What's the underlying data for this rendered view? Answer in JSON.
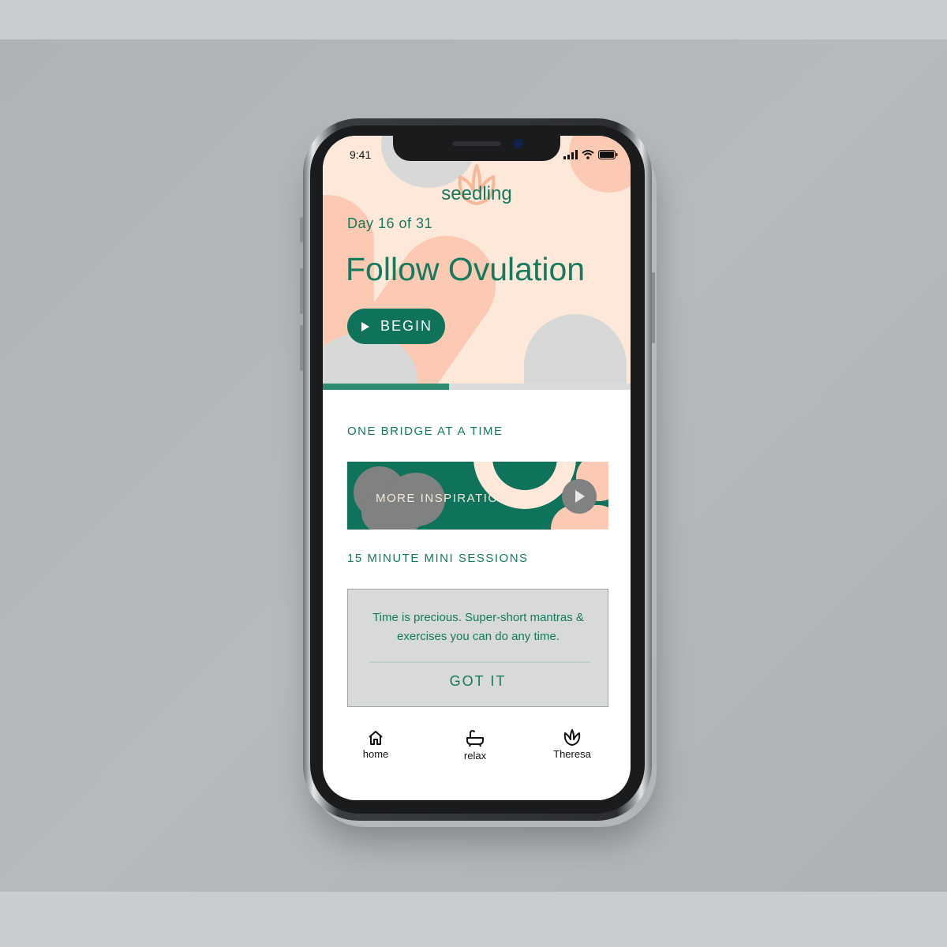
{
  "status_bar": {
    "time": "9:41"
  },
  "app": {
    "name": "seedling"
  },
  "hero": {
    "day_label": "Day 16 of 31",
    "title": "Follow Ovulation",
    "begin_label": "BEGIN",
    "progress": 0.41
  },
  "sections": {
    "inspiration_heading": "ONE BRIDGE AT A TIME",
    "inspiration_button": "MORE INSPIRATION",
    "mini_heading": "15 MINUTE MINI SESSIONS"
  },
  "info_card": {
    "text": "Time is precious.  Super-short mantras & exercises you can do any time.",
    "button": "GOT IT"
  },
  "nav": {
    "items": [
      {
        "label": "home",
        "icon": "home-icon"
      },
      {
        "label": "relax",
        "icon": "bathtub-icon"
      },
      {
        "label": "Theresa",
        "icon": "lotus-icon"
      }
    ]
  },
  "colors": {
    "accent": "#0f725a",
    "text_green": "#137a5e",
    "peach": "#fcc9b2",
    "cream": "#fde8da",
    "grey_shape": "#d7d8d8"
  }
}
